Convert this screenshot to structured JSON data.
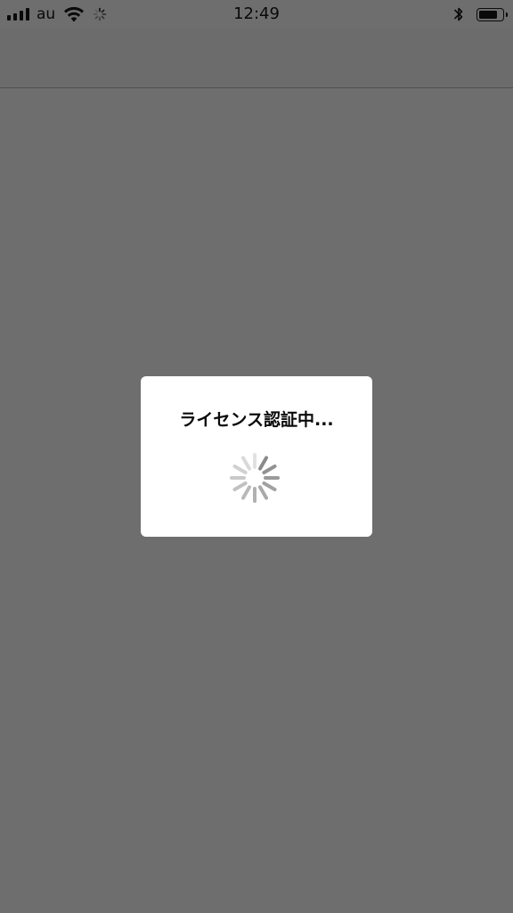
{
  "status_bar": {
    "carrier": "au",
    "time": "12:49",
    "signal_bars": 4,
    "battery_level": 0.8,
    "icons": [
      "signal-icon",
      "wifi-icon",
      "activity-spinner-icon",
      "bluetooth-icon",
      "battery-icon"
    ]
  },
  "dialog": {
    "title": "ライセンス認証中..."
  },
  "colors": {
    "background_dim": "#6e6e6e",
    "dialog_bg": "#ffffff",
    "text": "#0b0b0b",
    "spinner": "#8a8a8a"
  }
}
